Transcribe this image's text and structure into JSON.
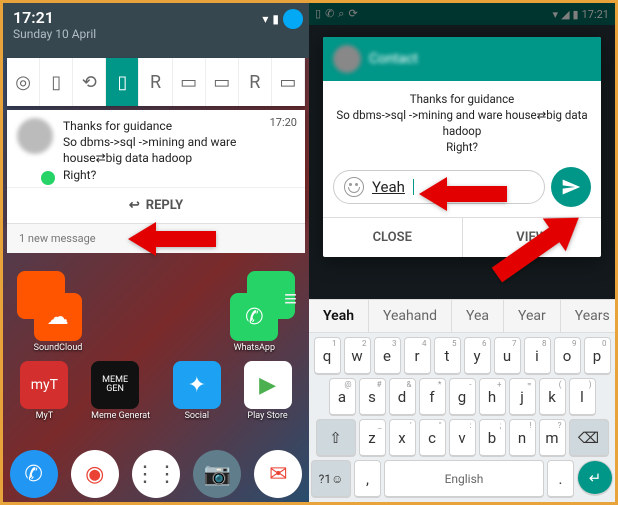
{
  "left": {
    "status": {
      "time": "17:21",
      "date": "Sunday 10 April"
    },
    "notification": {
      "time": "17:20",
      "line1": "Thanks for guidance",
      "line2": "So dbms->sql ->mining and ware house⇄big data hadoop",
      "line3": "Right?",
      "reply_label": "REPLY",
      "new_message": "1 new message"
    },
    "apps": {
      "soundcloud": "SoundCloud",
      "whatsapp": "WhatsApp",
      "myt": "MyT",
      "meme": "Meme Generat",
      "social": "Social",
      "play": "Play Store"
    }
  },
  "right": {
    "status_time": "17:21",
    "popup": {
      "contact": "Contact",
      "line1": "Thanks for guidance",
      "line2": "So dbms->sql ->mining and ware house⇄big data hadoop",
      "line3": "Right?",
      "input_value": "Yeah",
      "close": "CLOSE",
      "view": "VIEW"
    },
    "suggestions": [
      "Yeah",
      "Yeahand",
      "Yea",
      "Year",
      "Years"
    ],
    "keyboard": {
      "row1": [
        [
          "q",
          "1"
        ],
        [
          "w",
          "2"
        ],
        [
          "e",
          "3"
        ],
        [
          "r",
          "4"
        ],
        [
          "t",
          "5"
        ],
        [
          "y",
          "6"
        ],
        [
          "u",
          "7"
        ],
        [
          "i",
          "8"
        ],
        [
          "o",
          "9"
        ],
        [
          "p",
          "0"
        ]
      ],
      "row2": [
        [
          "a",
          "@"
        ],
        [
          "s",
          "#"
        ],
        [
          "d",
          "&"
        ],
        [
          "f",
          "*"
        ],
        [
          "g",
          "-"
        ],
        [
          "h",
          "+"
        ],
        [
          "j",
          "="
        ],
        [
          "k",
          "("
        ],
        [
          "l",
          ")"
        ]
      ],
      "row3": [
        [
          "z",
          "_"
        ],
        [
          "x",
          "′"
        ],
        [
          "c",
          "″"
        ],
        [
          "v",
          ":"
        ],
        [
          "b",
          ";"
        ],
        [
          "n",
          "!"
        ],
        [
          "m",
          "?"
        ]
      ],
      "sym": "?1☺",
      "space": "English"
    }
  }
}
